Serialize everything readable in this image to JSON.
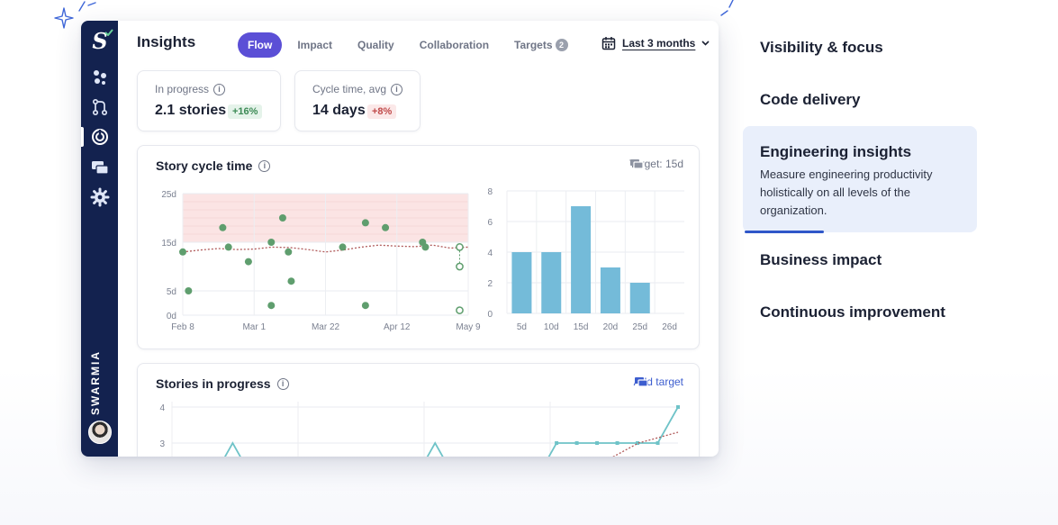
{
  "app": {
    "brand": "SWARMIA",
    "title": "Insights",
    "tabs": [
      {
        "label": "Flow",
        "active": true
      },
      {
        "label": "Impact"
      },
      {
        "label": "Quality"
      },
      {
        "label": "Collaboration"
      },
      {
        "label": "Targets",
        "badge": "2"
      }
    ],
    "date_range": "Last 3 months",
    "stats": [
      {
        "label": "In progress",
        "value": "2.1 stories",
        "delta": "+16%",
        "delta_kind": "positive"
      },
      {
        "label": "Cycle time, avg",
        "value": "14 days",
        "delta": "+8%",
        "delta_kind": "negative"
      }
    ],
    "cycle_card": {
      "title": "Story cycle time",
      "target": "Target: 15d"
    },
    "progress_card": {
      "title": "Stories in progress",
      "action": "Add target"
    }
  },
  "menu": [
    {
      "label": "Visibility & focus"
    },
    {
      "label": "Code delivery"
    },
    {
      "label": "Engineering insights",
      "description": "Measure engineering productivity holistically on all levels of the organization.",
      "active": true
    },
    {
      "label": "Business impact"
    },
    {
      "label": "Continuous improvement"
    }
  ],
  "colors": {
    "accent": "#5b4fd6",
    "rail": "#13224f",
    "points": "#5f9e6e",
    "bars": "#74bbd9",
    "target_band": "#fbe4e4",
    "line": "#6fc3c8"
  },
  "chart_data": [
    {
      "type": "scatter",
      "title": "Story cycle time",
      "x_ticks": [
        "Feb 8",
        "Mar 1",
        "Mar 22",
        "Apr 12",
        "May 9"
      ],
      "y_ticks": [
        "25d",
        "15d",
        "5d",
        "0d"
      ],
      "ylim": [
        0,
        25
      ],
      "target": 15,
      "points": [
        {
          "x": 0.0,
          "y": 13
        },
        {
          "x": 0.02,
          "y": 5
        },
        {
          "x": 0.14,
          "y": 18
        },
        {
          "x": 0.16,
          "y": 14
        },
        {
          "x": 0.23,
          "y": 11
        },
        {
          "x": 0.31,
          "y": 15
        },
        {
          "x": 0.31,
          "y": 2
        },
        {
          "x": 0.35,
          "y": 20
        },
        {
          "x": 0.37,
          "y": 13
        },
        {
          "x": 0.38,
          "y": 7
        },
        {
          "x": 0.56,
          "y": 14
        },
        {
          "x": 0.64,
          "y": 19
        },
        {
          "x": 0.64,
          "y": 2
        },
        {
          "x": 0.71,
          "y": 18
        },
        {
          "x": 0.84,
          "y": 15
        },
        {
          "x": 0.85,
          "y": 14
        },
        {
          "x": 0.97,
          "y": 14,
          "open": true
        },
        {
          "x": 0.97,
          "y": 10,
          "open": true
        },
        {
          "x": 0.97,
          "y": 1,
          "open": true
        }
      ],
      "trend": [
        13,
        13.4,
        13.7,
        13.5,
        13.6,
        14,
        13.9,
        13.5,
        13,
        13.4,
        14,
        14.4,
        14.2,
        14.1,
        14.4,
        13.8,
        14
      ]
    },
    {
      "type": "bar",
      "categories": [
        "5d",
        "10d",
        "15d",
        "20d",
        "25d",
        "26d"
      ],
      "values": [
        4,
        4,
        7,
        3,
        2,
        0
      ],
      "y_ticks": [
        "8",
        "6",
        "4",
        "2",
        "0"
      ],
      "ylim": [
        0,
        8
      ]
    },
    {
      "type": "line",
      "title": "Stories in progress",
      "y_ticks": [
        "4",
        "3"
      ],
      "values": [
        2,
        2,
        2,
        3,
        2,
        2,
        2,
        2,
        2,
        2,
        2,
        2,
        2,
        3,
        2,
        2,
        2,
        2,
        2,
        3,
        3,
        3,
        3,
        3,
        3,
        4
      ],
      "trend": [
        2,
        2,
        2.1,
        2.2,
        2.6,
        2.8,
        3.0,
        3.1,
        3.2,
        3.3
      ]
    }
  ]
}
